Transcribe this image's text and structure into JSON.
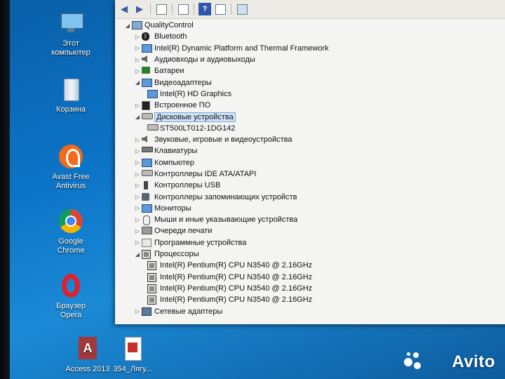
{
  "desktop": {
    "icons": [
      {
        "label": "Этот компьютер",
        "icon": "this-pc-icon"
      },
      {
        "label": "Корзина",
        "icon": "recycle-bin-icon"
      },
      {
        "label": "Avast Free Antivirus",
        "icon": "avast-icon"
      },
      {
        "label": "Google Chrome",
        "icon": "chrome-icon"
      },
      {
        "label": "Браузер Opera",
        "icon": "opera-icon"
      },
      {
        "label": "Access 2013",
        "icon": "access-icon"
      },
      {
        "label": "354_Лягу...",
        "icon": "pdf-file-icon"
      }
    ]
  },
  "device_manager": {
    "root": "QualityControl",
    "items": [
      {
        "label": "Bluetooth",
        "icon": "bluetooth-icon",
        "expanded": false
      },
      {
        "label": "Intel(R) Dynamic Platform and Thermal Framework",
        "icon": "monitor-icon",
        "expanded": false
      },
      {
        "label": "Аудиовходы и аудиовыходы",
        "icon": "speaker-icon",
        "expanded": false
      },
      {
        "label": "Батареи",
        "icon": "battery-icon",
        "expanded": false
      },
      {
        "label": "Видеоадаптеры",
        "icon": "display-adapter-icon",
        "expanded": true,
        "children": [
          "Intel(R) HD Graphics"
        ]
      },
      {
        "label": "Встроенное ПО",
        "icon": "firmware-icon",
        "expanded": false
      },
      {
        "label": "Дисковые устройства",
        "icon": "disk-icon",
        "expanded": true,
        "selected": true,
        "children": [
          "ST500LT012-1DG142"
        ]
      },
      {
        "label": "Звуковые, игровые и видеоустройства",
        "icon": "speaker-icon",
        "expanded": false
      },
      {
        "label": "Клавиатуры",
        "icon": "keyboard-icon",
        "expanded": false
      },
      {
        "label": "Компьютер",
        "icon": "computer-icon",
        "expanded": false
      },
      {
        "label": "Контроллеры IDE ATA/ATAPI",
        "icon": "controller-icon",
        "expanded": false
      },
      {
        "label": "Контроллеры USB",
        "icon": "usb-icon",
        "expanded": false
      },
      {
        "label": "Контроллеры запоминающих устройств",
        "icon": "storage-controller-icon",
        "expanded": false
      },
      {
        "label": "Мониторы",
        "icon": "monitor-icon",
        "expanded": false
      },
      {
        "label": "Мыши и иные указывающие устройства",
        "icon": "mouse-icon",
        "expanded": false
      },
      {
        "label": "Очереди печати",
        "icon": "printer-icon",
        "expanded": false
      },
      {
        "label": "Программные устройства",
        "icon": "software-device-icon",
        "expanded": false
      },
      {
        "label": "Процессоры",
        "icon": "processor-icon",
        "expanded": true,
        "children": [
          "Intel(R) Pentium(R) CPU  N3540  @ 2.16GHz",
          "Intel(R) Pentium(R) CPU  N3540  @ 2.16GHz",
          "Intel(R) Pentium(R) CPU  N3540  @ 2.16GHz",
          "Intel(R) Pentium(R) CPU  N3540  @ 2.16GHz"
        ]
      },
      {
        "label": "Сетевые адаптеры",
        "icon": "network-adapter-icon",
        "expanded": false
      }
    ]
  },
  "watermark": "Avito",
  "colors": {
    "desktop_blue": "#0c74c7",
    "selection": "#cfe3f7",
    "window_bg": "#f4f4f2"
  }
}
